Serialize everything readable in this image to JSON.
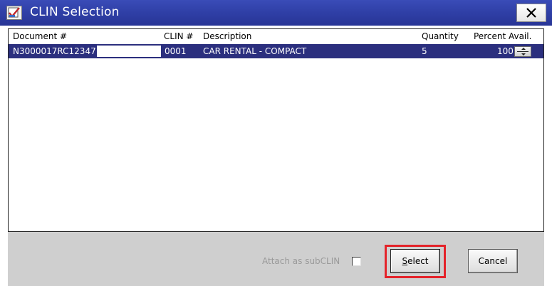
{
  "window": {
    "title": "CLIN Selection",
    "app_icon": "checkmark-document-icon",
    "close_glyph": "✕"
  },
  "table": {
    "headers": {
      "document": "Document #",
      "clin": "CLIN #",
      "description": "Description",
      "quantity": "Quantity",
      "percent": "Percent Avail."
    },
    "rows": [
      {
        "document": "N3000017RC12347",
        "clin": "0001",
        "description": "CAR RENTAL - COMPACT",
        "quantity": "5",
        "percent": "100"
      }
    ],
    "selected_row_color": "#2b2f7e"
  },
  "footer": {
    "attach_label": "Attach as subCLIN",
    "attach_checked": false,
    "select_label_mnemonic": "S",
    "select_label_rest": "elect",
    "cancel_label": "Cancel",
    "highlight_color": "#e4232a"
  }
}
